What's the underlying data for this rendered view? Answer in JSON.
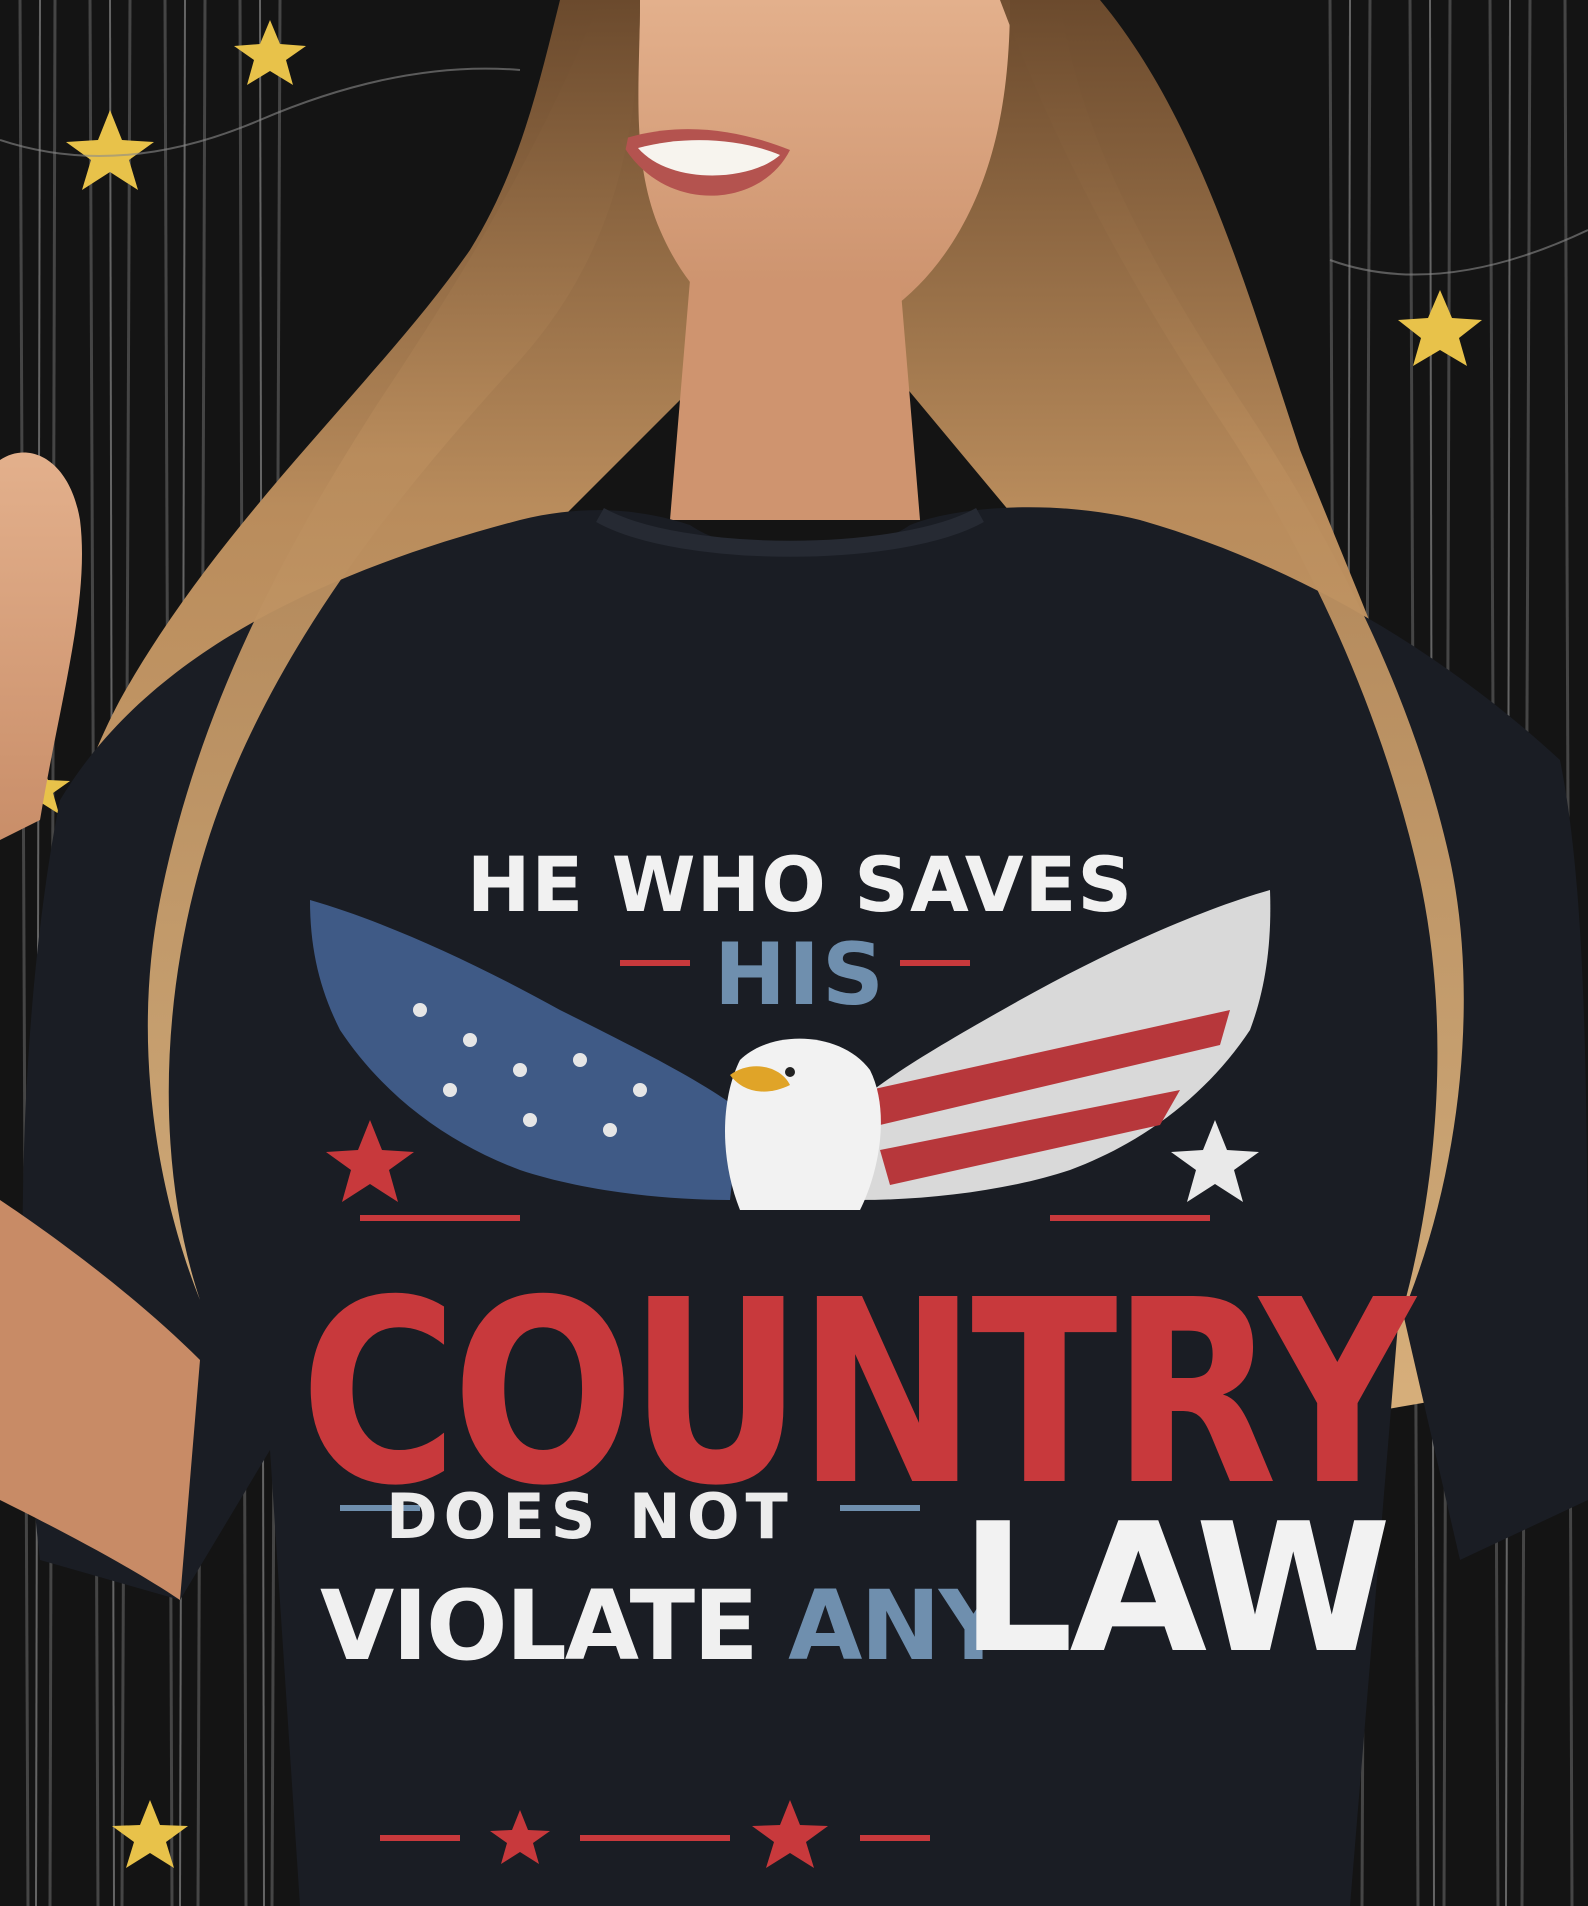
{
  "shirt_print": {
    "line1": "HE WHO SAVES",
    "line2": "HIS",
    "line3": "COUNTRY",
    "line4": "DOES NOT",
    "line5_word1": "VIOLATE",
    "line5_word2": "ANY",
    "line6": "LAW"
  },
  "colors": {
    "shirt": "#1a1d24",
    "hair": "#b58a5a",
    "skin": "#d9a37f",
    "red": "#c8393c",
    "blue": "#6f8fae",
    "white": "#f1f1f1",
    "gold_star": "#e8c24a"
  }
}
